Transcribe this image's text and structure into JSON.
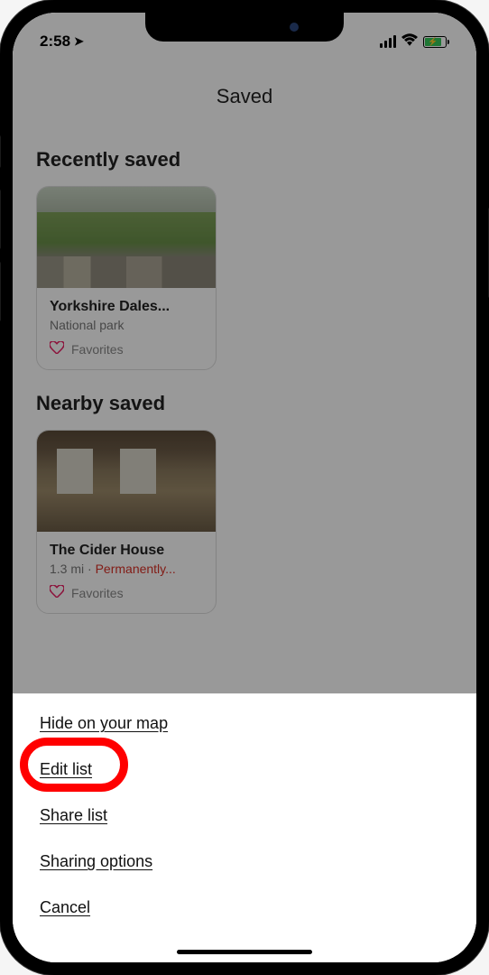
{
  "statusbar": {
    "time": "2:58"
  },
  "header": {
    "title": "Saved"
  },
  "sections": {
    "recent": {
      "title": "Recently saved",
      "card": {
        "title": "Yorkshire Dales...",
        "subtitle": "National park",
        "list_label": "Favorites"
      }
    },
    "nearby": {
      "title": "Nearby saved",
      "card": {
        "title": "The Cider House",
        "distance": "1.3 mi",
        "status": "Permanently...",
        "list_label": "Favorites"
      }
    }
  },
  "sheet": {
    "items": [
      "Hide on your map",
      "Edit list",
      "Share list",
      "Sharing options",
      "Cancel"
    ]
  }
}
